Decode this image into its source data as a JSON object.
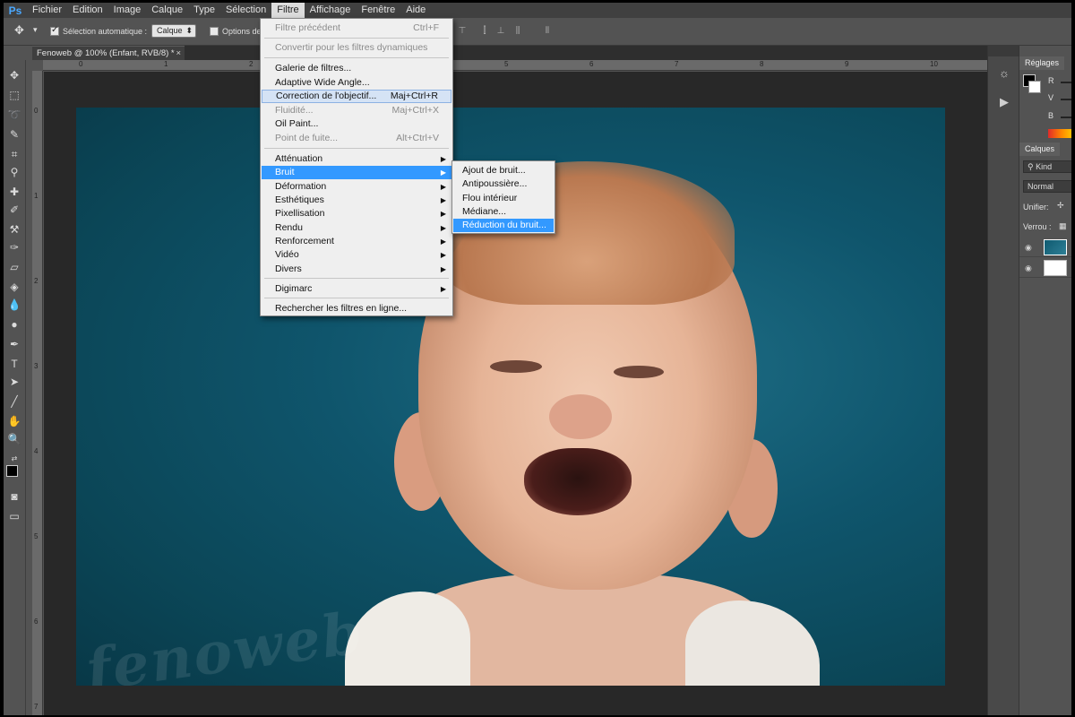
{
  "app": {
    "logo": "Ps",
    "menus": [
      "Fichier",
      "Edition",
      "Image",
      "Calque",
      "Type",
      "Sélection",
      "Filtre",
      "Affichage",
      "Fenêtre",
      "Aide"
    ],
    "active_menu": "Filtre"
  },
  "options_bar": {
    "auto_select_label": "Sélection automatique :",
    "auto_select_value": "Calque",
    "transform_label": "Options de"
  },
  "document": {
    "tab_title": "Fenoweb @ 100% (Enfant, RVB/8) *",
    "close": "×",
    "watermark": "fenoweb"
  },
  "rulers": {
    "top_ticks": [
      "0",
      "1",
      "2",
      "3",
      "4",
      "5",
      "6",
      "7",
      "8",
      "9",
      "10"
    ],
    "left_ticks": [
      "0",
      "1",
      "2",
      "3",
      "4",
      "5",
      "6",
      "7"
    ]
  },
  "filter_menu": {
    "items": [
      {
        "label": "Filtre précédent",
        "shortcut": "Ctrl+F",
        "disabled": true
      },
      {
        "label": "Convertir pour les filtres dynamiques",
        "shortcut": "",
        "disabled": true
      },
      {
        "label": "Galerie de filtres...",
        "shortcut": ""
      },
      {
        "label": "Adaptive Wide Angle...",
        "shortcut": ""
      },
      {
        "label": "Correction de l'objectif...",
        "shortcut": "Maj+Ctrl+R"
      },
      {
        "label": "Fluidité...",
        "shortcut": "Maj+Ctrl+X",
        "disabled": true
      },
      {
        "label": "Oil Paint...",
        "shortcut": ""
      },
      {
        "label": "Point de fuite...",
        "shortcut": "Alt+Ctrl+V",
        "disabled": true
      },
      {
        "label": "Atténuation",
        "submenu": true
      },
      {
        "label": "Bruit",
        "submenu": true
      },
      {
        "label": "Déformation",
        "submenu": true
      },
      {
        "label": "Esthétiques",
        "submenu": true
      },
      {
        "label": "Pixellisation",
        "submenu": true
      },
      {
        "label": "Rendu",
        "submenu": true
      },
      {
        "label": "Renforcement",
        "submenu": true
      },
      {
        "label": "Vidéo",
        "submenu": true
      },
      {
        "label": "Divers",
        "submenu": true
      },
      {
        "label": "Digimarc",
        "submenu": true
      },
      {
        "label": "Rechercher les filtres en ligne...",
        "shortcut": ""
      }
    ]
  },
  "noise_submenu": {
    "items": [
      "Ajout de bruit...",
      "Antipoussière...",
      "Flou intérieur",
      "Médiane...",
      "Réduction du bruit..."
    ]
  },
  "panels": {
    "adjust_tab": "Réglages",
    "color_r": "R",
    "color_v": "V",
    "color_b": "B",
    "layers_tab": "Calques",
    "kind": "Kind",
    "blend_mode": "Normal",
    "unify": "Unifier:",
    "lock": "Verrou :"
  },
  "icons": {
    "submenu_arrow": "▶",
    "eye": "👁"
  }
}
